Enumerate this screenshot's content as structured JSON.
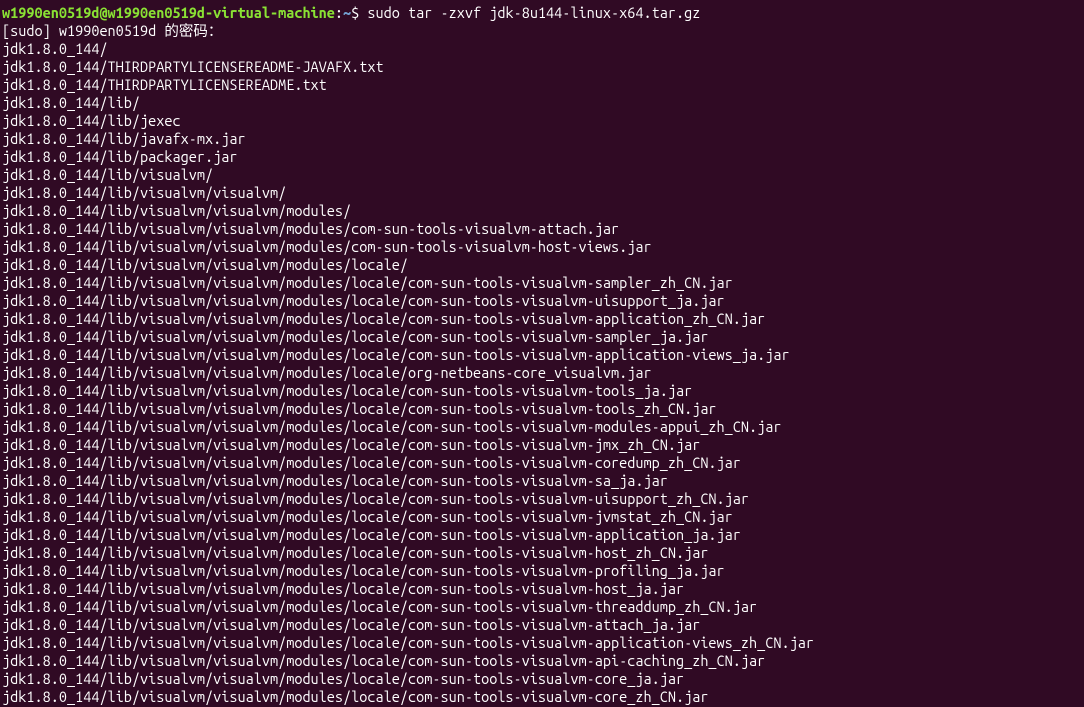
{
  "prompt": {
    "userhost": "w1990en0519d@w1990en0519d-virtual-machine",
    "colon": ":",
    "path": "~",
    "dollar": "$ "
  },
  "command": "sudo tar -zxvf jdk-8u144-linux-x64.tar.gz",
  "sudo_prompt": "[sudo] w1990en0519d 的密码：",
  "output_lines": [
    "jdk1.8.0_144/",
    "jdk1.8.0_144/THIRDPARTYLICENSEREADME-JAVAFX.txt",
    "jdk1.8.0_144/THIRDPARTYLICENSEREADME.txt",
    "jdk1.8.0_144/lib/",
    "jdk1.8.0_144/lib/jexec",
    "jdk1.8.0_144/lib/javafx-mx.jar",
    "jdk1.8.0_144/lib/packager.jar",
    "jdk1.8.0_144/lib/visualvm/",
    "jdk1.8.0_144/lib/visualvm/visualvm/",
    "jdk1.8.0_144/lib/visualvm/visualvm/modules/",
    "jdk1.8.0_144/lib/visualvm/visualvm/modules/com-sun-tools-visualvm-attach.jar",
    "jdk1.8.0_144/lib/visualvm/visualvm/modules/com-sun-tools-visualvm-host-views.jar",
    "jdk1.8.0_144/lib/visualvm/visualvm/modules/locale/",
    "jdk1.8.0_144/lib/visualvm/visualvm/modules/locale/com-sun-tools-visualvm-sampler_zh_CN.jar",
    "jdk1.8.0_144/lib/visualvm/visualvm/modules/locale/com-sun-tools-visualvm-uisupport_ja.jar",
    "jdk1.8.0_144/lib/visualvm/visualvm/modules/locale/com-sun-tools-visualvm-application_zh_CN.jar",
    "jdk1.8.0_144/lib/visualvm/visualvm/modules/locale/com-sun-tools-visualvm-sampler_ja.jar",
    "jdk1.8.0_144/lib/visualvm/visualvm/modules/locale/com-sun-tools-visualvm-application-views_ja.jar",
    "jdk1.8.0_144/lib/visualvm/visualvm/modules/locale/org-netbeans-core_visualvm.jar",
    "jdk1.8.0_144/lib/visualvm/visualvm/modules/locale/com-sun-tools-visualvm-tools_ja.jar",
    "jdk1.8.0_144/lib/visualvm/visualvm/modules/locale/com-sun-tools-visualvm-tools_zh_CN.jar",
    "jdk1.8.0_144/lib/visualvm/visualvm/modules/locale/com-sun-tools-visualvm-modules-appui_zh_CN.jar",
    "jdk1.8.0_144/lib/visualvm/visualvm/modules/locale/com-sun-tools-visualvm-jmx_zh_CN.jar",
    "jdk1.8.0_144/lib/visualvm/visualvm/modules/locale/com-sun-tools-visualvm-coredump_zh_CN.jar",
    "jdk1.8.0_144/lib/visualvm/visualvm/modules/locale/com-sun-tools-visualvm-sa_ja.jar",
    "jdk1.8.0_144/lib/visualvm/visualvm/modules/locale/com-sun-tools-visualvm-uisupport_zh_CN.jar",
    "jdk1.8.0_144/lib/visualvm/visualvm/modules/locale/com-sun-tools-visualvm-jvmstat_zh_CN.jar",
    "jdk1.8.0_144/lib/visualvm/visualvm/modules/locale/com-sun-tools-visualvm-application_ja.jar",
    "jdk1.8.0_144/lib/visualvm/visualvm/modules/locale/com-sun-tools-visualvm-host_zh_CN.jar",
    "jdk1.8.0_144/lib/visualvm/visualvm/modules/locale/com-sun-tools-visualvm-profiling_ja.jar",
    "jdk1.8.0_144/lib/visualvm/visualvm/modules/locale/com-sun-tools-visualvm-host_ja.jar",
    "jdk1.8.0_144/lib/visualvm/visualvm/modules/locale/com-sun-tools-visualvm-threaddump_zh_CN.jar",
    "jdk1.8.0_144/lib/visualvm/visualvm/modules/locale/com-sun-tools-visualvm-attach_ja.jar",
    "jdk1.8.0_144/lib/visualvm/visualvm/modules/locale/com-sun-tools-visualvm-application-views_zh_CN.jar",
    "jdk1.8.0_144/lib/visualvm/visualvm/modules/locale/com-sun-tools-visualvm-api-caching_zh_CN.jar",
    "jdk1.8.0_144/lib/visualvm/visualvm/modules/locale/com-sun-tools-visualvm-core_ja.jar",
    "jdk1.8.0_144/lib/visualvm/visualvm/modules/locale/com-sun-tools-visualvm-core_zh_CN.jar"
  ]
}
